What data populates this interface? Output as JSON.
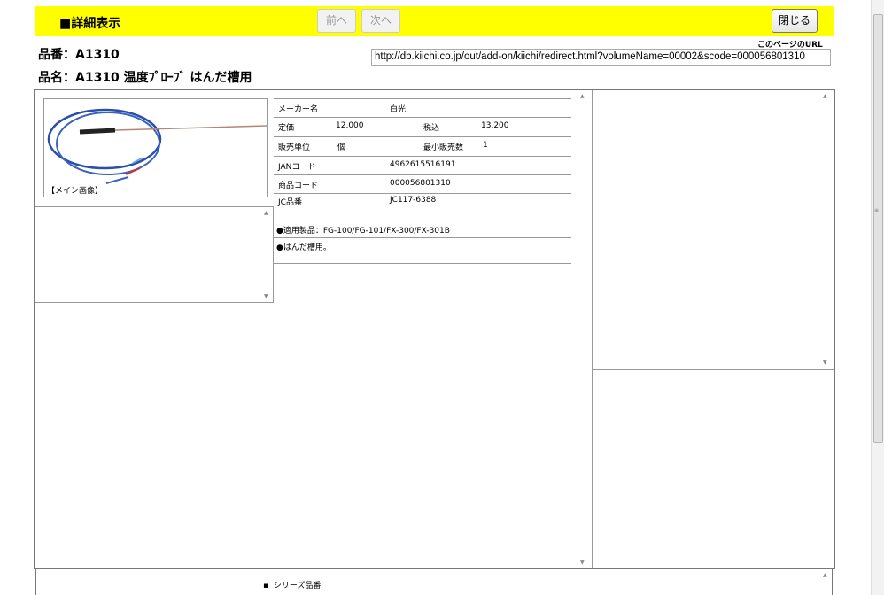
{
  "header": {
    "title": "■詳細表示",
    "prev_label": "前へ",
    "next_label": "次へ",
    "close_label": "閉じる"
  },
  "product": {
    "item_no": "品番：A1310",
    "item_name": "品名：A1310 温度ﾌﾟﾛｰﾌﾞ はんだ槽用"
  },
  "page_url": {
    "label": "このページのURL",
    "value": "http://db.kiichi.co.jp/out/add-on/kiichi/redirect.html?volumeName=00002&scode=000056801310"
  },
  "image": {
    "caption": "【メイン画像】"
  },
  "specs": {
    "maker_label": "メーカー名",
    "maker_value": "白光",
    "list_price_label": "定価",
    "list_price_value": "12,000",
    "tax_label": "税込",
    "tax_value": "13,200",
    "unit_label": "販売単位",
    "unit_value": "個",
    "min_qty_label": "最小販売数",
    "min_qty_value": "1",
    "jan_label": "JANコード",
    "jan_value": "4962615516191",
    "product_code_label": "商品コード",
    "product_code_value": "000056801310",
    "jc_label": "JC品番",
    "jc_value": "JC117-6388"
  },
  "description": {
    "line1": "●適用製品：FG-100/FG-101/FX-300/FX-301B",
    "line2": "●はんだ槽用。"
  },
  "series": {
    "label": "シリーズ品番"
  },
  "colors": {
    "header_bg": "#ffff00"
  }
}
